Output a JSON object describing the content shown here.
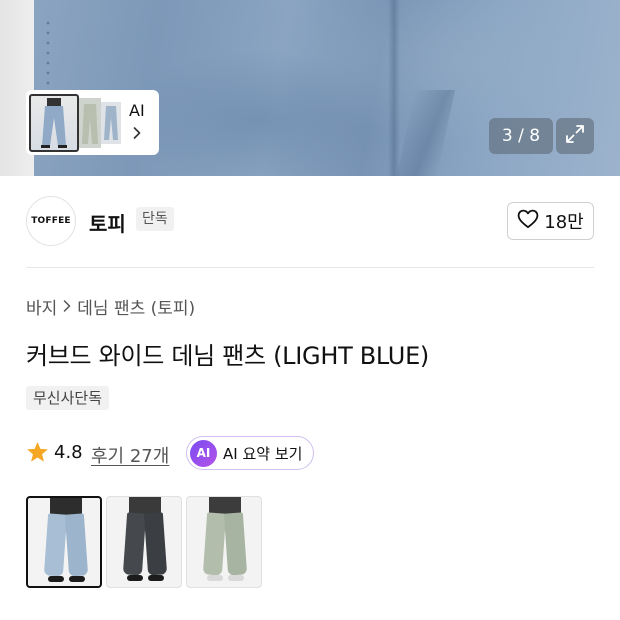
{
  "gallery": {
    "ai_label": "AI",
    "counter": "3 / 8"
  },
  "brand": {
    "logo_text": "TOFFEE",
    "name": "토피",
    "tag": "단독",
    "like_count": "18만"
  },
  "breadcrumb": {
    "category": "바지",
    "subcategory": "데님 팬츠 (토피)"
  },
  "product": {
    "title": "커브드 와이드 데님 팬츠 (LIGHT BLUE)",
    "badge": "무신사단독",
    "rating": "4.8",
    "reviews": "후기 27개",
    "ai_badge": "AI",
    "ai_summary": "AI 요약 보기"
  },
  "options": [
    {
      "color": "#9bb4cd",
      "selected": true
    },
    {
      "color": "#3b3e42",
      "selected": false
    },
    {
      "color": "#a9b5a4",
      "selected": false
    }
  ],
  "colors": {
    "accent_ai": "#8a4ff0",
    "star": "#f5a623"
  },
  "icons": {
    "like": "heart-outline-icon",
    "expand": "expand-arrows-icon",
    "chevron": "chevron-right-icon",
    "rating": "star-icon"
  }
}
